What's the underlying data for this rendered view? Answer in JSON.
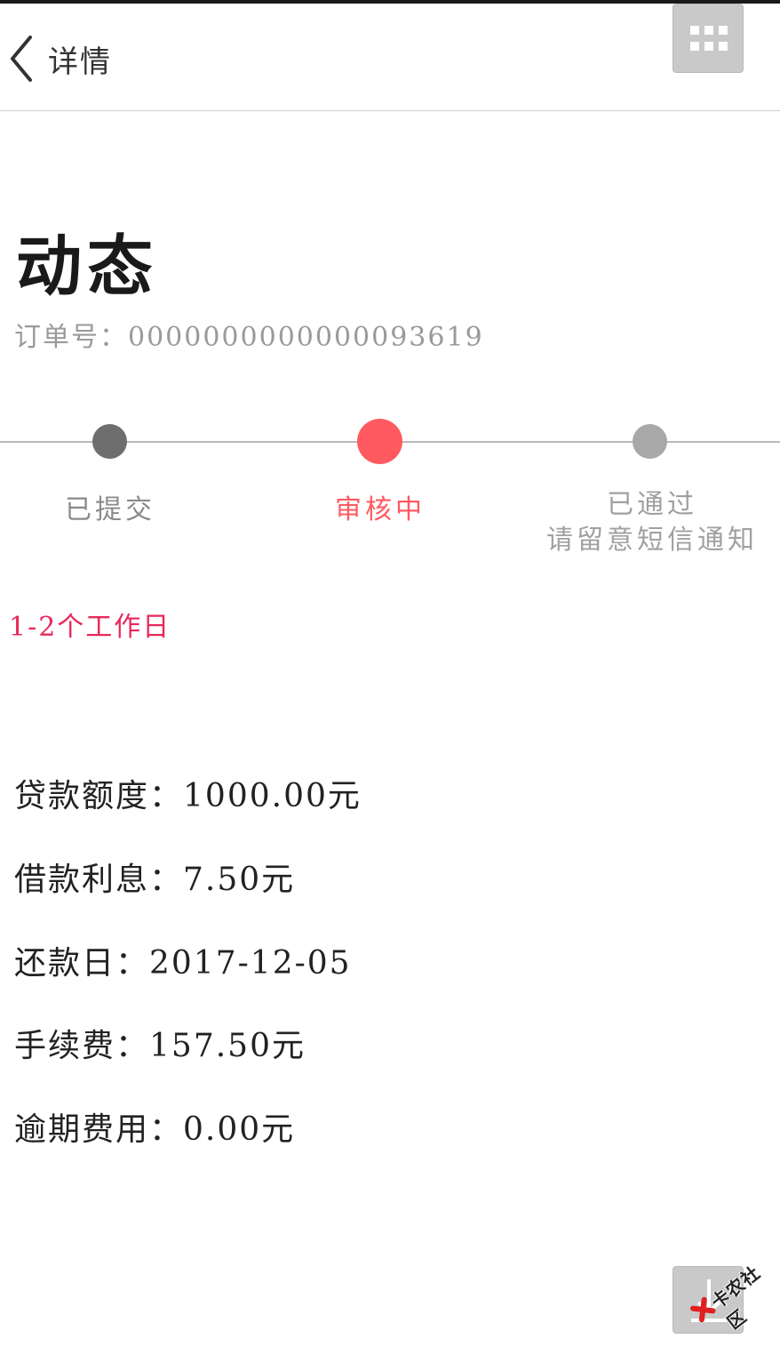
{
  "header": {
    "back_icon": "chevron-left-icon",
    "title": "详情",
    "menu_icon": "grid-menu-icon"
  },
  "status": {
    "title": "动态",
    "order_label": "订单号：",
    "order_number": "0000000000000093619"
  },
  "progress": {
    "steps": [
      {
        "label": "已提交",
        "sub": "",
        "state": "done",
        "color": "#6e6e6e"
      },
      {
        "label": "审核中",
        "sub": "",
        "state": "current",
        "color": "#ff5a5f"
      },
      {
        "label": "已通过",
        "sub": "请留意短信通知",
        "state": "pending",
        "color": "#a8a8a8"
      }
    ],
    "duration": "1-2个工作日"
  },
  "details": [
    {
      "label": "贷款额度：",
      "value": "1000.00元"
    },
    {
      "label": "借款利息：",
      "value": "7.50元"
    },
    {
      "label": "还款日：",
      "value": "2017-12-05"
    },
    {
      "label": "手续费：",
      "value": "157.50元"
    },
    {
      "label": "逾期费用：",
      "value": "0.00元"
    }
  ],
  "floating": {
    "icon": "download-icon",
    "watermark": "卡农社区"
  },
  "colors": {
    "accent": "#ff5a5f",
    "duration_text": "#e8285a"
  }
}
